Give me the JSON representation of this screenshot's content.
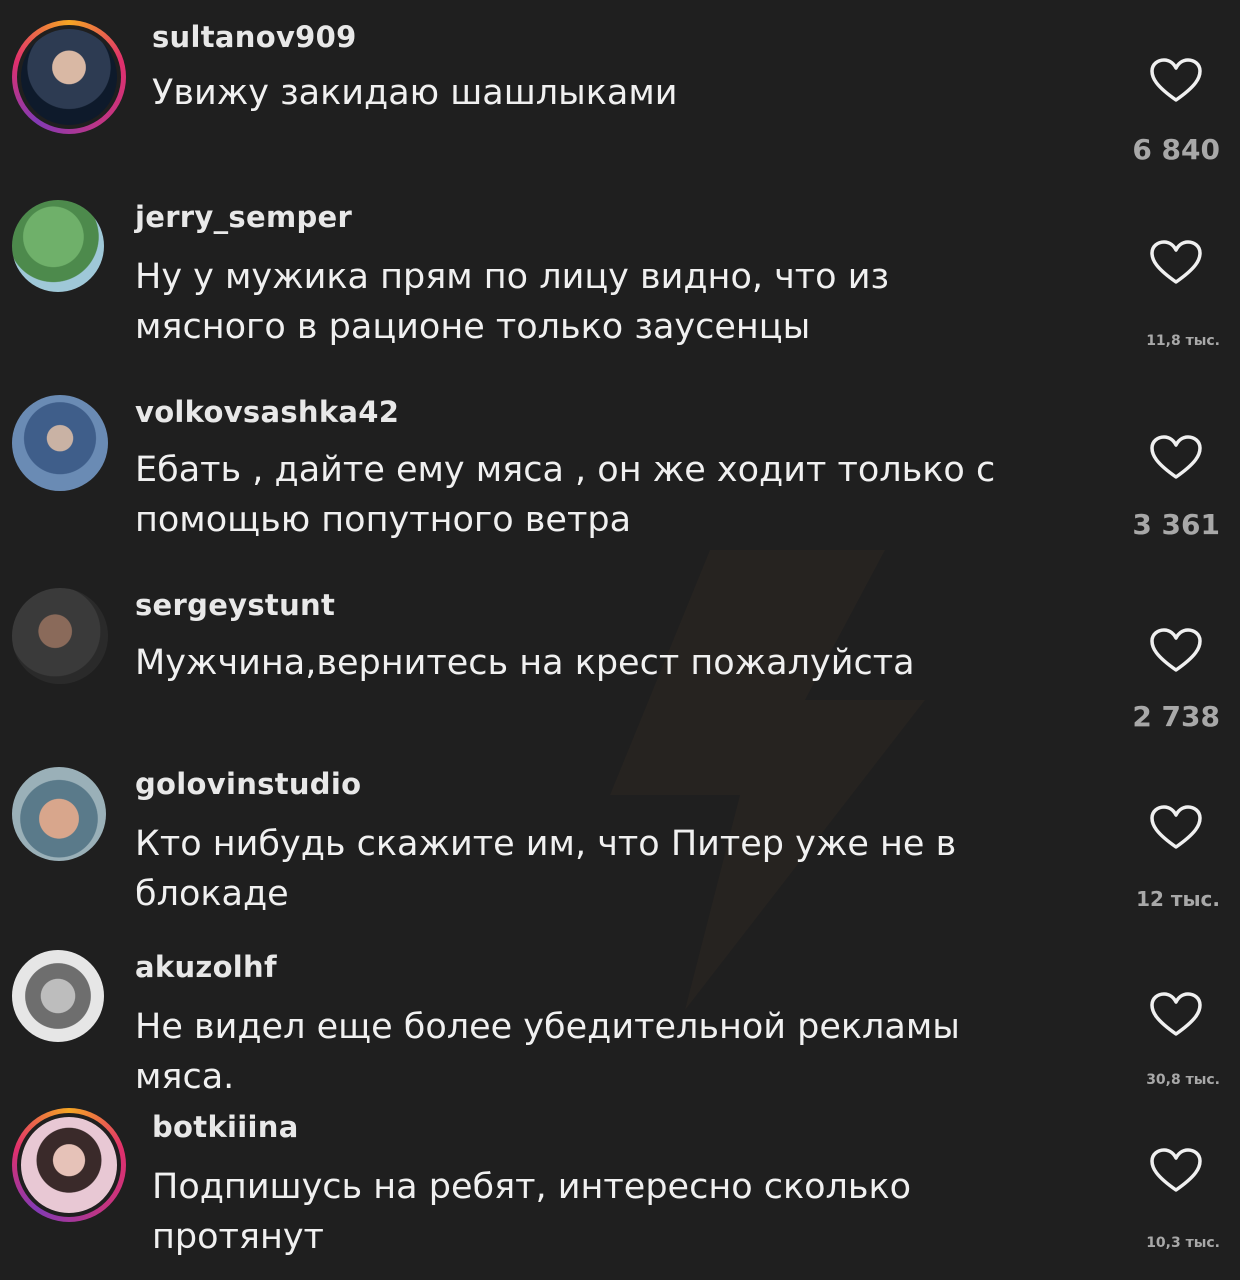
{
  "comments": [
    {
      "username": "sultanov909",
      "text": "Увижу закидаю шашлыками",
      "likes": "6 840"
    },
    {
      "username": "jerry_semper",
      "text": "Ну у мужика прям по лицу видно, что из\nмясного в рационе только заусенцы",
      "likes": "11,8 тыс."
    },
    {
      "username": "volkovsashka42",
      "text": "Ебать , дайте ему мяса , он же ходит только с\nпомощью попутного ветра",
      "likes": "3 361"
    },
    {
      "username": "sergeystunt",
      "text": "Мужчина,вернитесь на крест пожалуйста",
      "likes": "2 738"
    },
    {
      "username": "golovinstudio",
      "text": "Кто нибудь скажите им, что Питер уже не в\nблокаде",
      "likes": "12 тыс."
    },
    {
      "username": "akuzolhf",
      "text": "Не видел еще более убедительной рекламы\nмяса.",
      "likes": "30,8 тыс."
    },
    {
      "username": "botkiiina",
      "text": "Подпишусь на ребят, интересно сколько\nпротянут",
      "likes": "10,3 тыс."
    }
  ],
  "icons": {
    "like": "heart-outline-icon",
    "watermark": "lightning-bolt-icon"
  },
  "colors": {
    "background": "#1f1f1f",
    "text": "#f0f0f0",
    "muted": "#a8a8a8",
    "story_ring": "#e1306c"
  }
}
